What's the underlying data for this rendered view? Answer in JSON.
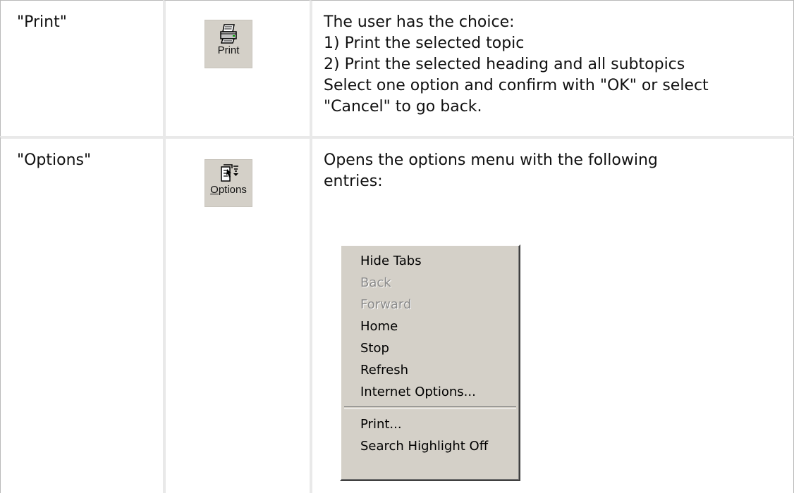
{
  "rows": [
    {
      "term": "\"Print\"",
      "button": {
        "label": "Print",
        "icon": "printer-icon"
      },
      "description": [
        "The user has the choice:",
        "1) Print the selected topic",
        "2) Print the selected heading and all subtopics",
        "Select one option and confirm with \"OK\" or select",
        "\"Cancel\" to go back."
      ]
    },
    {
      "term": "\"Options\"",
      "button": {
        "label_mnemonic": "O",
        "label_rest": "ptions",
        "icon": "options-icon"
      },
      "description": [
        "Opens the options menu with the following",
        "entries:"
      ]
    }
  ],
  "options_menu": {
    "group1": [
      {
        "label": "Hide Tabs",
        "enabled": true
      },
      {
        "label": "Back",
        "enabled": false
      },
      {
        "label": "Forward",
        "enabled": false
      },
      {
        "label": "Home",
        "enabled": true
      },
      {
        "label": "Stop",
        "enabled": true
      },
      {
        "label": "Refresh",
        "enabled": true
      },
      {
        "label": "Internet Options...",
        "enabled": true
      }
    ],
    "group2": [
      {
        "label": "Print...",
        "enabled": true
      },
      {
        "label": "Search Highlight Off",
        "enabled": true
      }
    ]
  },
  "colors": {
    "menu_background": "#d4d0c8",
    "disabled_text": "#8a8a8a",
    "cell_divider": "#e9e9e9",
    "outer_border": "#b9b9b9"
  }
}
